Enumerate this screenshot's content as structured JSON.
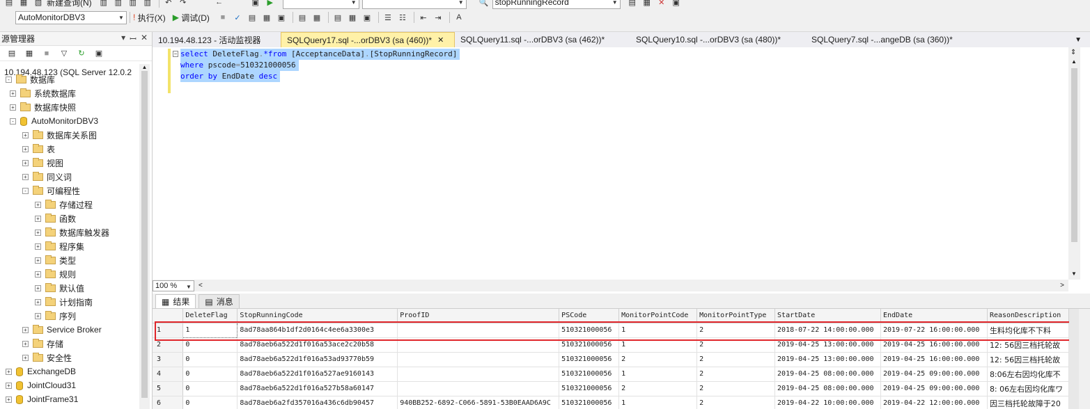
{
  "toolbar": {
    "new_query_label": "新建查询(N)",
    "database_combo": "AutoMonitorDBV3",
    "execute_label": "执行(X)",
    "debug_label": "调试(D)",
    "search_combo": "stopRunningRecord"
  },
  "object_explorer": {
    "title": "源管理器",
    "server": "10.194.48.123 (SQL Server 12.0.2",
    "nodes": [
      {
        "label": "数据库",
        "type": "folder"
      },
      {
        "label": "系统数据库",
        "type": "folder"
      },
      {
        "label": "数据库快照",
        "type": "folder"
      },
      {
        "label": "AutoMonitorDBV3",
        "type": "db"
      },
      {
        "label": "数据库关系图",
        "type": "folder"
      },
      {
        "label": "表",
        "type": "folder"
      },
      {
        "label": "视图",
        "type": "folder"
      },
      {
        "label": "同义词",
        "type": "folder"
      },
      {
        "label": "可编程性",
        "type": "folder"
      },
      {
        "label": "存储过程",
        "type": "folder"
      },
      {
        "label": "函数",
        "type": "folder"
      },
      {
        "label": "数据库触发器",
        "type": "folder"
      },
      {
        "label": "程序集",
        "type": "folder"
      },
      {
        "label": "类型",
        "type": "folder"
      },
      {
        "label": "规则",
        "type": "folder"
      },
      {
        "label": "默认值",
        "type": "folder"
      },
      {
        "label": "计划指南",
        "type": "folder"
      },
      {
        "label": "序列",
        "type": "folder"
      },
      {
        "label": "Service Broker",
        "type": "folder"
      },
      {
        "label": "存储",
        "type": "folder"
      },
      {
        "label": "安全性",
        "type": "folder"
      },
      {
        "label": "ExchangeDB",
        "type": "db"
      },
      {
        "label": "JointCloud31",
        "type": "db"
      },
      {
        "label": "JointFrame31",
        "type": "db"
      }
    ]
  },
  "tabs": [
    {
      "label": "10.194.48.123 - 活动监视器"
    },
    {
      "label": "SQLQuery17.sql -...orDBV3 (sa (460))*"
    },
    {
      "label": "SQLQuery11.sql -...orDBV3 (sa (462))*"
    },
    {
      "label": "SQLQuery10.sql -...orDBV3 (sa (480))*"
    },
    {
      "label": "SQLQuery7.sql -...angeDB (sa (360))*"
    }
  ],
  "editor": {
    "line1": {
      "kw1": "select",
      "t1": " DeleteFlag",
      "g1": ".",
      "kw2": "*from",
      "t2": " [AcceptanceData]",
      "g2": ".",
      "t3": "[StopRunningRecord]"
    },
    "line2": {
      "kw1": "where",
      "t1": " pscode",
      "g1": "=",
      "t2": "510321000056"
    },
    "line3": {
      "kw1": "order by",
      "t1": " EndDate ",
      "kw2": "desc"
    },
    "zoom": "100 %"
  },
  "results": {
    "tab_results": "结果",
    "tab_messages": "消息",
    "columns": [
      "DeleteFlag",
      "StopRunningCode",
      "ProofID",
      "PSCode",
      "MonitorPointCode",
      "MonitorPointType",
      "StartDate",
      "EndDate",
      "ReasonDescription"
    ],
    "rows": [
      [
        "1",
        "1",
        "8ad78aa864b1df2d0164c4ee6a3300e3",
        "",
        "510321000056",
        "1",
        "2",
        "2018-07-22 14:00:00.000",
        "2019-07-22 16:00:00.000",
        "生料均化库不下料"
      ],
      [
        "2",
        "0",
        "8ad78aeb6a522d1f016a53ace2c20b58",
        "",
        "510321000056",
        "1",
        "2",
        "2019-04-25 13:00:00.000",
        "2019-04-25 16:00:00.000",
        "12: 56因三档托轮故"
      ],
      [
        "3",
        "0",
        "8ad78aeb6a522d1f016a53ad93770b59",
        "",
        "510321000056",
        "2",
        "2",
        "2019-04-25 13:00:00.000",
        "2019-04-25 16:00:00.000",
        "12: 56因三档托轮故"
      ],
      [
        "4",
        "0",
        "8ad78aeb6a522d1f016a527ae9160143",
        "",
        "510321000056",
        "1",
        "2",
        "2019-04-25 08:00:00.000",
        "2019-04-25 09:00:00.000",
        "8:06左右因均化库不"
      ],
      [
        "5",
        "0",
        "8ad78aeb6a522d1f016a527b58a60147",
        "",
        "510321000056",
        "2",
        "2",
        "2019-04-25 08:00:00.000",
        "2019-04-25 09:00:00.000",
        "8: 06左右因均化库ワ"
      ],
      [
        "6",
        "0",
        "8ad78aeb6a2fd357016a436c6db90457",
        "940BB252-6892-C066-5891-53B0EAAD6A9C",
        "510321000056",
        "1",
        "2",
        "2019-04-22 10:00:00.000",
        "2019-04-22 12:00:00.000",
        "因三档托轮故障于20"
      ]
    ]
  }
}
